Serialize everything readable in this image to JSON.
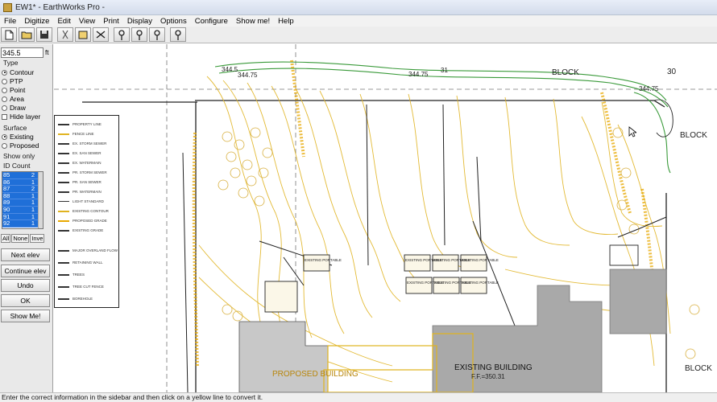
{
  "window": {
    "title": "EW1* - EarthWorks Pro -"
  },
  "menu": [
    "File",
    "Digitize",
    "Edit",
    "View",
    "Print",
    "Display",
    "Options",
    "Configure",
    "Show me!",
    "Help"
  ],
  "toolbar": {
    "icons": [
      "new-icon",
      "open-icon",
      "save-icon",
      "cut-icon",
      "paste-icon",
      "crop-icon",
      "pin-icon",
      "pin-b-icon",
      "pin-c-icon",
      "pin-d-icon"
    ]
  },
  "sidebar": {
    "elevation_value": "345.5",
    "elevation_unit": "ft",
    "type_label": "Type",
    "type_options": [
      "Contour",
      "PTP",
      "Point",
      "Area",
      "Draw"
    ],
    "hide_layer_label": "Hide layer",
    "surface_label": "Surface",
    "surface_options": [
      "Existing",
      "Proposed"
    ],
    "show_only_label": "Show only",
    "list_header": "ID  Count",
    "id_rows": [
      {
        "id": "85",
        "count": "2"
      },
      {
        "id": "86",
        "count": "1"
      },
      {
        "id": "87",
        "count": "2"
      },
      {
        "id": "88",
        "count": "1"
      },
      {
        "id": "89",
        "count": "1"
      },
      {
        "id": "90",
        "count": "1"
      },
      {
        "id": "91",
        "count": "1"
      },
      {
        "id": "92",
        "count": "1"
      }
    ],
    "select_buttons": [
      "All",
      "None",
      "Inve"
    ],
    "next_elev": "Next elev",
    "continue_elev": "Continue elev",
    "undo": "Undo",
    "ok": "OK",
    "show_me": "Show Me!"
  },
  "drawing": {
    "labels": {
      "block_top": "BLOCK",
      "block_right": "BLOCK",
      "block_bottom": "BLOCK",
      "existing_building": "EXISTING BUILDING",
      "ff": "F.F.=350.31",
      "proposed_building": "PROPOSED BUILDING",
      "elev_1": "344.5",
      "elev_2": "344.75",
      "elev_3": "344.75",
      "elev_4": "344.75",
      "num_31": "31",
      "num_30": "30"
    },
    "legend_rows": [
      "PROPERTY LINE",
      "FENCE LINE",
      "EX. STORM SEWER",
      "EX. SAN SEWER",
      "EX. WATERMAIN",
      "PR. STORM SEWER",
      "PR. SAN SEWER",
      "PR. WATERMAIN",
      "LIGHT STANDARD",
      "EXISTING CONTOUR",
      "PROPOSED GRADE",
      "EXISTING GRADE",
      "MAJOR OVERLAND FLOW",
      "RETAINING WALL",
      "TREES",
      "TREE CUT FENCE",
      "BOREHOLE"
    ],
    "portables": [
      "EXISTING PORTABLE",
      "EXISTING PORTABLE",
      "EXISTING PORTABLE",
      "EXISTING PORTABLE",
      "EXISTING PORTABLE",
      "EXISTING PORTABLE",
      "EXISTING PORTABLE"
    ],
    "colors": {
      "contour": "#e0b320",
      "contour_dense": "#e8a800",
      "green_contour": "#3a9a3a",
      "line": "#222222",
      "building": "#9a9a9a"
    }
  },
  "status": {
    "text": "Enter the correct information in the sidebar and then click on a yellow line to convert it."
  }
}
